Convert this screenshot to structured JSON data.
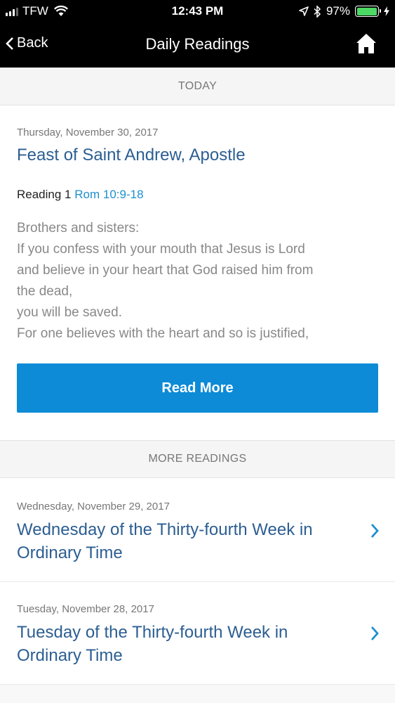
{
  "status_bar": {
    "carrier": "TFW",
    "time": "12:43 PM",
    "battery": "97%",
    "battery_level": 0.97,
    "icons": [
      "signal-icon",
      "wifi-icon",
      "location-arrow-icon",
      "bluetooth-icon",
      "battery-icon",
      "charging-icon"
    ]
  },
  "nav": {
    "back_label": "Back",
    "title": "Daily Readings",
    "home_icon": "home-icon"
  },
  "today": {
    "section_label": "TODAY",
    "date": "Thursday, November 30, 2017",
    "title": "Feast of Saint Andrew, Apostle",
    "reading_label": "Reading 1",
    "reading_ref": "Rom 10:9-18",
    "excerpt": [
      "Brothers and sisters:",
      "If you confess with your mouth that Jesus is Lord",
      "and believe in your heart that God raised him from",
      "the dead,",
      "you will be saved.",
      "For one believes with the heart and so is justified,"
    ],
    "read_more_label": "Read More"
  },
  "more": {
    "section_label": "MORE READINGS",
    "items": [
      {
        "date": "Wednesday, November 29, 2017",
        "title_line1": "Wednesday of the Thirty-fourth Week in",
        "title_line2": "Ordinary Time"
      },
      {
        "date": "Tuesday, November 28, 2017",
        "title_line1": "Tuesday of the Thirty-fourth Week in",
        "title_line2": "Ordinary Time"
      }
    ]
  },
  "colors": {
    "accent": "#0d8bd6",
    "title_blue": "#2c5e92",
    "reference_blue": "#1d8fcf",
    "battery_green": "#4cd964"
  }
}
